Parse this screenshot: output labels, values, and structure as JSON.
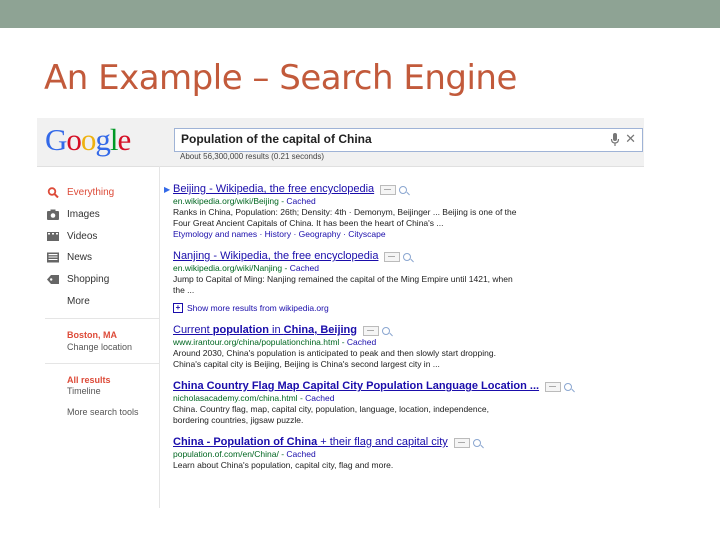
{
  "slide": {
    "title": "An Example – Search Engine"
  },
  "header": {
    "logo_letters": [
      "G",
      "o",
      "o",
      "g",
      "l",
      "e"
    ],
    "query": "Population of the capital of China",
    "stats": "About 56,300,000 results (0.21 seconds)"
  },
  "sidebar": {
    "nav": [
      {
        "label": "Everything",
        "icon": "search-icon",
        "active": true
      },
      {
        "label": "Images",
        "icon": "camera-icon"
      },
      {
        "label": "Videos",
        "icon": "film-icon"
      },
      {
        "label": "News",
        "icon": "newspaper-icon"
      },
      {
        "label": "Shopping",
        "icon": "tag-icon"
      },
      {
        "label": "More"
      }
    ],
    "location": "Boston, MA",
    "change_location": "Change location",
    "all_results": "All results",
    "timeline": "Timeline",
    "more_tools": "More search tools"
  },
  "results": [
    {
      "title": "Beijing - Wikipedia, the free encyclopedia",
      "url": "en.wikipedia.org/wiki/Beijing",
      "cached": "Cached",
      "snippet_1": "Ranks in China, Population: 26th; Density: 4th · Demonym, Beijinger ... Beijing is one of the",
      "snippet_2": "Four Great Ancient Capitals of China. It has been the heart of China's ...",
      "sublinks": "Etymology and names · History · Geography · Cityscape"
    },
    {
      "title": "Nanjing - Wikipedia, the free encyclopedia",
      "url": "en.wikipedia.org/wiki/Nanjing",
      "cached": "Cached",
      "snippet_1": "Jump to Capital of Ming: Nanjing remained the capital of the Ming Empire until 1421, when",
      "snippet_2": "the ..."
    },
    {
      "more_results": "Show more results from wikipedia.org"
    },
    {
      "title_a": "Current ",
      "title_b": "population",
      "title_c": " in ",
      "title_d": "China, Beijing",
      "url": "www.irantour.org/china/populationchina.html",
      "cached": "Cached",
      "snippet_1": "Around 2030, China's population is anticipated to peak and then slowly start dropping.",
      "snippet_2": "China's capital city is Beijing, Beijing is China's second largest city in ..."
    },
    {
      "title": "China Country Flag Map Capital City Population Language Location ...",
      "url": "nicholasacademy.com/china.html",
      "cached": "Cached",
      "snippet_1": "China. Country flag, map, capital city, population, language, location, independence,",
      "snippet_2": "bordering countries, jigsaw puzzle."
    },
    {
      "title_a": "China - Population of China",
      "title_b": " + their flag and capital city",
      "url": "population.of.com/en/China/",
      "cached": "Cached",
      "snippet_1": "Learn about China's population, capital city, flag and more."
    }
  ]
}
